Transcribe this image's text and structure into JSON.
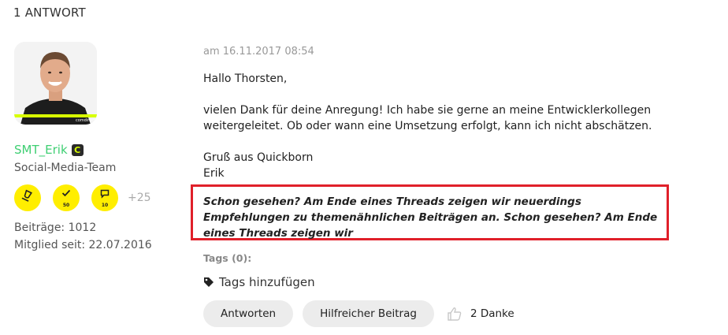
{
  "header": {
    "reply_count": "1 ANTWORT"
  },
  "author": {
    "name": "SMT_Erik",
    "rank_badge": "C",
    "role": "Social-Media-Team",
    "avatar_caption": "comdirect",
    "badges": [
      {
        "icon": "trophy-icon",
        "count": ""
      },
      {
        "icon": "checkmark-icon",
        "count": "50"
      },
      {
        "icon": "speech-bubble-icon",
        "count": "10"
      }
    ],
    "more_badges": "+25",
    "posts": "Beiträge: 1012",
    "member_since": "Mitglied seit: 22.07.2016"
  },
  "post": {
    "date": "am 16.11.2017 08:54",
    "greeting": "Hallo Thorsten,",
    "body": "vielen Dank für deine Anregung! Ich habe sie gerne an meine Entwicklerkollegen weitergeleitet. Ob oder wann eine Umsetzung erfolgt, kann ich nicht abschätzen.",
    "signoff": "Gruß aus Quickborn",
    "signature": "Erik",
    "highlight": "Schon gesehen? Am Ende eines Threads zeigen wir neuerdings Empfehlungen zu themenähnlichen Beiträgen an. Schon gesehen? Am Ende eines Threads zeigen wir"
  },
  "tags": {
    "label": "Tags (0):",
    "add_label": "Tags hinzufügen"
  },
  "actions": {
    "reply_label": "Antworten",
    "helpful_label": "Hilfreicher Beitrag",
    "thanks_label": "2 Danke"
  },
  "colors": {
    "username": "#3fcf73",
    "badge": "#ffee00",
    "highlight_border": "#e0202a",
    "button_bg": "#ececec"
  }
}
